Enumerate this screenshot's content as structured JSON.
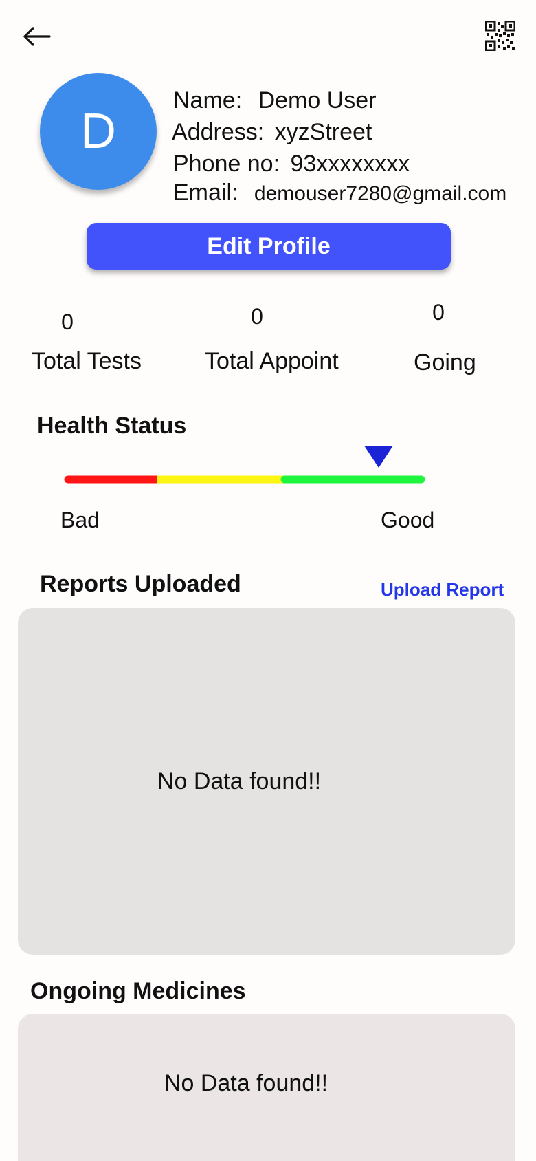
{
  "header": {
    "back_icon": "arrow-left-icon",
    "qr_icon": "qr-code-icon"
  },
  "profile": {
    "avatar_letter": "D",
    "avatar_color": "#3d8ceb",
    "name_label": "Name:",
    "name_value": "Demo User",
    "address_label": "Address:",
    "address_value": "xyzStreet",
    "phone_label": "Phone no:",
    "phone_value": "93xxxxxxxx",
    "email_label": "Email:",
    "email_value": "demouser7280@gmail.com",
    "edit_button_label": "Edit Profile",
    "edit_button_color": "#4353fb"
  },
  "stats": [
    {
      "value": "0",
      "label": "Total Tests"
    },
    {
      "value": "0",
      "label": "Total Appoint"
    },
    {
      "value": "0",
      "label": "Going"
    }
  ],
  "health_status": {
    "title": "Health Status",
    "low_label": "Bad",
    "high_label": "Good",
    "level": 0.87,
    "colors": [
      "#ff1515",
      "#fdf514",
      "#1ff53c"
    ],
    "marker_color": "#1a23d6"
  },
  "reports": {
    "title": "Reports Uploaded",
    "upload_link": "Upload Report",
    "empty_text": "No Data found!!"
  },
  "medicines": {
    "title": "Ongoing Medicines",
    "empty_text": "No Data found!!"
  }
}
